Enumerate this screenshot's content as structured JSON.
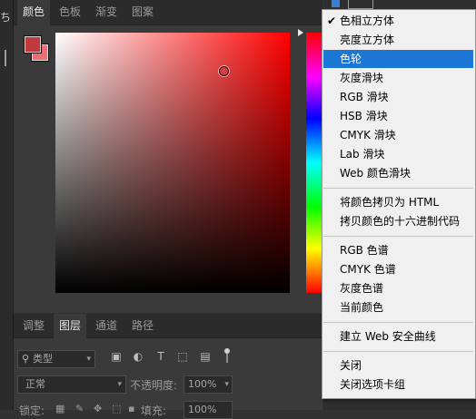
{
  "left_strip": {
    "glyph": "ち"
  },
  "color_panel": {
    "tabs": [
      {
        "label": "颜色",
        "active": true
      },
      {
        "label": "色板",
        "active": false
      },
      {
        "label": "渐变",
        "active": false
      },
      {
        "label": "图案",
        "active": false
      }
    ],
    "foreground_color": "#c0393e",
    "background_color": "#ec6f78",
    "hue_color": "#ff0000"
  },
  "layers_panel": {
    "tabs": [
      {
        "label": "调整",
        "active": false
      },
      {
        "label": "图层",
        "active": true
      },
      {
        "label": "通道",
        "active": false
      },
      {
        "label": "路径",
        "active": false
      }
    ],
    "filter": {
      "value": "类型"
    },
    "blend_mode": {
      "value": "正常"
    },
    "opacity": {
      "label": "不透明度:",
      "value": "100%"
    },
    "lock": {
      "label": "锁定:"
    },
    "fill": {
      "label": "填充:",
      "value": "100%"
    }
  },
  "menu": {
    "checked_item": "色相立方体",
    "highlighted_item": "色轮",
    "groups": [
      [
        "色相立方体",
        "亮度立方体",
        "色轮",
        "灰度滑块",
        "RGB 滑块",
        "HSB 滑块",
        "CMYK 滑块",
        "Lab 滑块",
        "Web 颜色滑块"
      ],
      [
        "将颜色拷贝为 HTML",
        "拷贝颜色的十六进制代码"
      ],
      [
        "RGB 色谱",
        "CMYK 色谱",
        "灰度色谱",
        "当前颜色"
      ],
      [
        "建立 Web 安全曲线"
      ],
      [
        "关闭",
        "关闭选项卡组"
      ]
    ]
  },
  "colors": {
    "panel_bg": "#3a3a3a",
    "tab_bar_bg": "#2b2b2b",
    "menu_bg": "#f0f0f0",
    "menu_highlight": "#1c76d6"
  }
}
